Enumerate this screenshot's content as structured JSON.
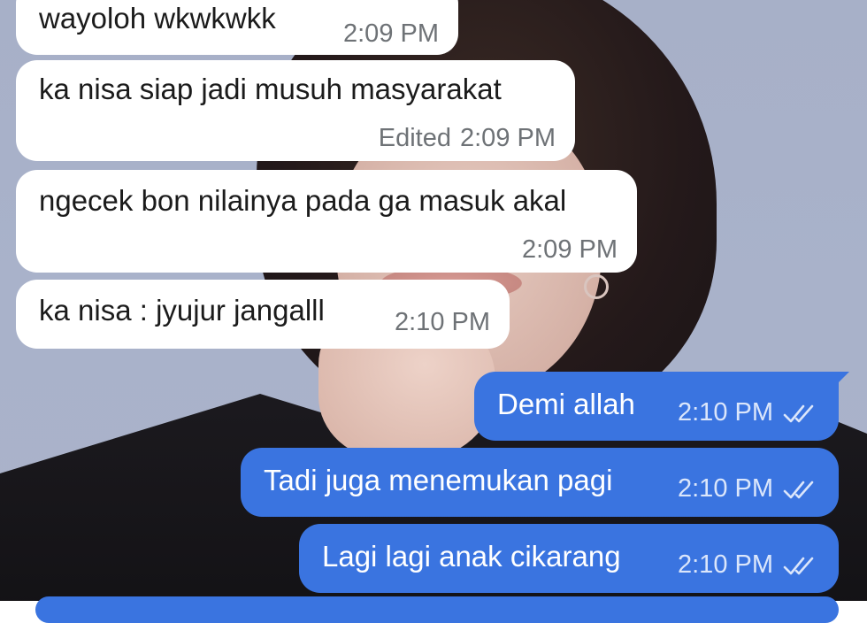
{
  "messages": [
    {
      "direction": "in",
      "text": "wayoloh wkwkwkk",
      "edited": "",
      "time": "2:09 PM"
    },
    {
      "direction": "in",
      "text": "ka nisa siap jadi musuh masyarakat",
      "edited": "Edited",
      "time": "2:09 PM"
    },
    {
      "direction": "in",
      "text": "ngecek bon nilainya pada ga masuk akal",
      "edited": "",
      "time": "2:09 PM"
    },
    {
      "direction": "in",
      "text": "ka nisa : jyujur jangalll",
      "edited": "",
      "time": "2:10 PM"
    },
    {
      "direction": "out",
      "text": "Demi allah",
      "time": "2:10 PM",
      "status_icon": "double-check-icon"
    },
    {
      "direction": "out",
      "text": "Tadi juga menemukan pagi",
      "time": "2:10 PM",
      "status_icon": "double-check-icon"
    },
    {
      "direction": "out",
      "text": "Lagi lagi anak cikarang",
      "time": "2:10 PM",
      "status_icon": "double-check-icon"
    }
  ],
  "colors": {
    "incoming_bubble": "#ffffff",
    "outgoing_bubble": "#3a74e0",
    "wallpaper": "#a9b2ca"
  }
}
